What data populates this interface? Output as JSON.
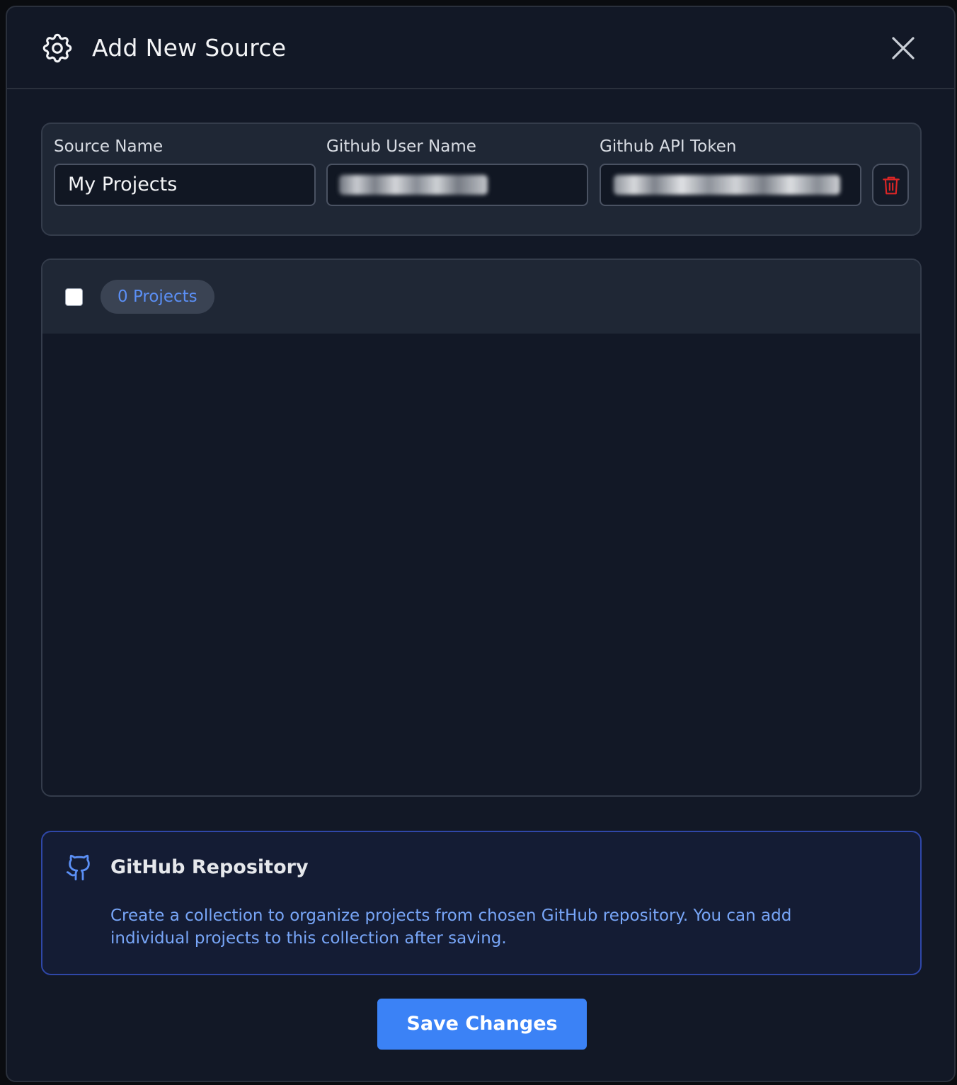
{
  "header": {
    "title": "Add New Source",
    "icon": "gear-icon",
    "close_icon": "close-icon"
  },
  "fields": {
    "source_name": {
      "label": "Source Name",
      "value": "My Projects"
    },
    "github_user": {
      "label": "Github User Name"
    },
    "api_token": {
      "label": "Github API Token"
    },
    "delete_icon": "trash-icon"
  },
  "projects": {
    "count_label": "0 Projects",
    "checked": false
  },
  "info": {
    "icon": "github-icon",
    "title": "GitHub Repository",
    "description": "Create a collection to organize projects from chosen GitHub repository. You can add individual projects to this collection after saving."
  },
  "footer": {
    "save_label": "Save Changes"
  },
  "colors": {
    "accent": "#3b82f6",
    "info_text": "#78a6f8",
    "danger": "#dc2626",
    "background": "#121826",
    "card": "#1f2735"
  }
}
